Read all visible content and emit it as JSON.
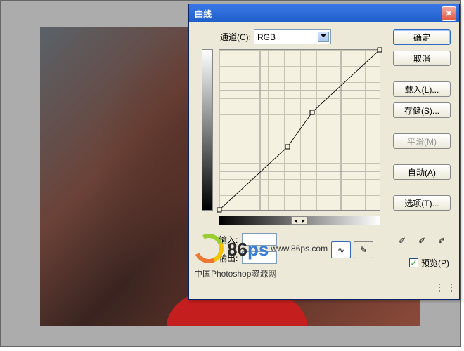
{
  "dialog": {
    "title": "曲线",
    "channel_label": "通道(C):",
    "channel_value": "RGB",
    "input_label": "输入:",
    "output_label": "输出:",
    "buttons": {
      "ok": "确定",
      "cancel": "取消",
      "load": "载入(L)...",
      "save": "存储(S)...",
      "smooth": "平滑(M)",
      "auto": "自动(A)",
      "options": "选项(T)..."
    },
    "preview_label": "预览(P)",
    "preview_checked": "✓"
  },
  "chart_data": {
    "type": "line",
    "title": "",
    "xlabel": "输入",
    "ylabel": "输出",
    "xlim": [
      0,
      255
    ],
    "ylim": [
      0,
      255
    ],
    "points": [
      {
        "x": 0,
        "y": 0
      },
      {
        "x": 109,
        "y": 101
      },
      {
        "x": 148,
        "y": 156
      },
      {
        "x": 255,
        "y": 255
      }
    ]
  },
  "watermark": {
    "brand_num": "86",
    "brand_ps": "ps",
    "url": "www.86ps.com",
    "tagline": "中国Photoshop资源网"
  },
  "icons": {
    "close": "✕",
    "curve": "∿",
    "pencil": "✎",
    "dropper": "✐"
  }
}
